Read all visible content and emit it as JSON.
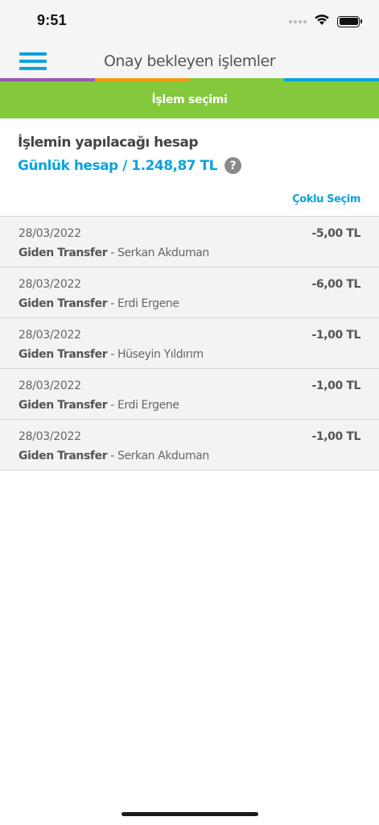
{
  "status": {
    "time": "9:51",
    "icons": [
      "cellular-signal-icon",
      "wifi-icon",
      "battery-icon"
    ]
  },
  "nav": {
    "title": "Onay bekleyen işlemler",
    "menu_icon": "hamburger-menu-icon"
  },
  "color_strip": [
    "#9b59b6",
    "#f39c12",
    "#84c83b",
    "#0aa3df"
  ],
  "selection_bar": {
    "label": "İşlem seçimi"
  },
  "account": {
    "label": "İşlemin yapılacağı hesap",
    "value": "Günlük hesap / 1.248,87 TL",
    "help_icon": "?",
    "multi_select_label": "Çoklu Seçim"
  },
  "transactions": [
    {
      "date": "28/03/2022",
      "type": "Giden Transfer",
      "recipient": " - Serkan Akduman",
      "amount": "-5,00 TL"
    },
    {
      "date": "28/03/2022",
      "type": "Giden Transfer",
      "recipient": " - Erdi Ergene",
      "amount": "-6,00 TL"
    },
    {
      "date": "28/03/2022",
      "type": "Giden Transfer",
      "recipient": " - Hüseyin Yıldırım",
      "amount": "-1,00 TL"
    },
    {
      "date": "28/03/2022",
      "type": "Giden Transfer",
      "recipient": " - Erdi Ergene",
      "amount": "-1,00 TL"
    },
    {
      "date": "28/03/2022",
      "type": "Giden Transfer",
      "recipient": " - Serkan Akduman",
      "amount": "-1,00 TL"
    }
  ],
  "colors": {
    "accent_blue": "#0aa3df",
    "accent_green": "#84c83b",
    "row_background": "#f3f3f3"
  }
}
